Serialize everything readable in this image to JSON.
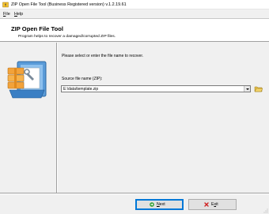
{
  "window": {
    "title": "ZIP Open File Tool (Business Registered version) v.1.2.19.61"
  },
  "menu": {
    "items": [
      {
        "label_underlined": "F",
        "label_rest": "ile"
      },
      {
        "label_underlined": "H",
        "label_rest": "elp"
      }
    ]
  },
  "header": {
    "title": "ZIP Open File Tool",
    "subtitle": "Program helps to recover a damaged/corrupted ZIP files."
  },
  "main": {
    "instruction": "Please select or enter the file name to recover.",
    "source_label": "Source file name (ZIP):",
    "source_value": "E:\\data\\template.zip"
  },
  "buttons": {
    "next": {
      "label_underlined": "N",
      "label_rest": "ext"
    },
    "exit": {
      "label_pre": "E",
      "label_underlined": "x",
      "label_rest": "it"
    }
  },
  "colors": {
    "accent": "#0078d7",
    "next_icon": "#2e9e2e",
    "exit_icon": "#d02020"
  }
}
